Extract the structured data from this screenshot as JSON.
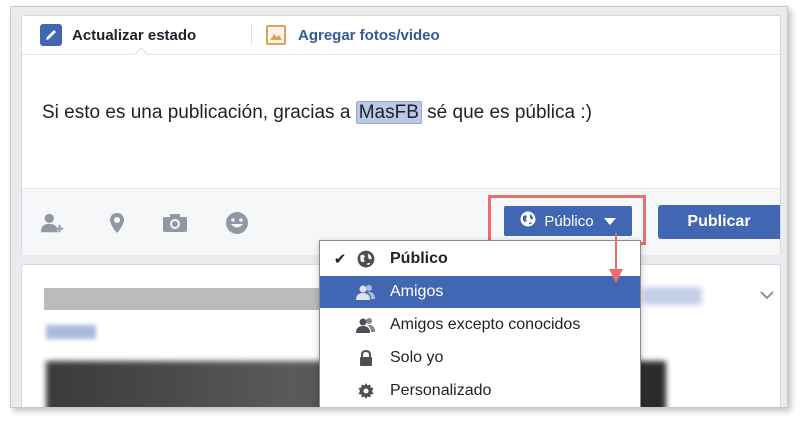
{
  "composer": {
    "tabs": [
      {
        "label": "Actualizar estado",
        "icon": "pencil-icon"
      },
      {
        "label": "Agregar fotos/video",
        "icon": "photo-icon"
      }
    ],
    "post_text_before": "Si esto es una publicación, gracias a ",
    "mention": "MasFB",
    "post_text_after": " sé que es pública :)",
    "toolbar_icons": [
      "tag-friends-icon",
      "location-icon",
      "camera-icon",
      "feeling-icon"
    ],
    "privacy_label": "Público",
    "publish_label": "Publicar"
  },
  "privacy_menu": {
    "items": [
      {
        "label": "Público",
        "icon": "globe-icon",
        "checked": true,
        "bold": true
      },
      {
        "label": "Amigos",
        "icon": "friends-icon",
        "highlighted": true
      },
      {
        "label": "Amigos excepto conocidos",
        "icon": "friends-except-icon"
      },
      {
        "label": "Solo yo",
        "icon": "lock-icon"
      },
      {
        "label": "Personalizado",
        "icon": "gear-icon"
      }
    ]
  },
  "colors": {
    "brand": "#4267b2",
    "annotation": "#f06b6b",
    "link": "#365899"
  }
}
